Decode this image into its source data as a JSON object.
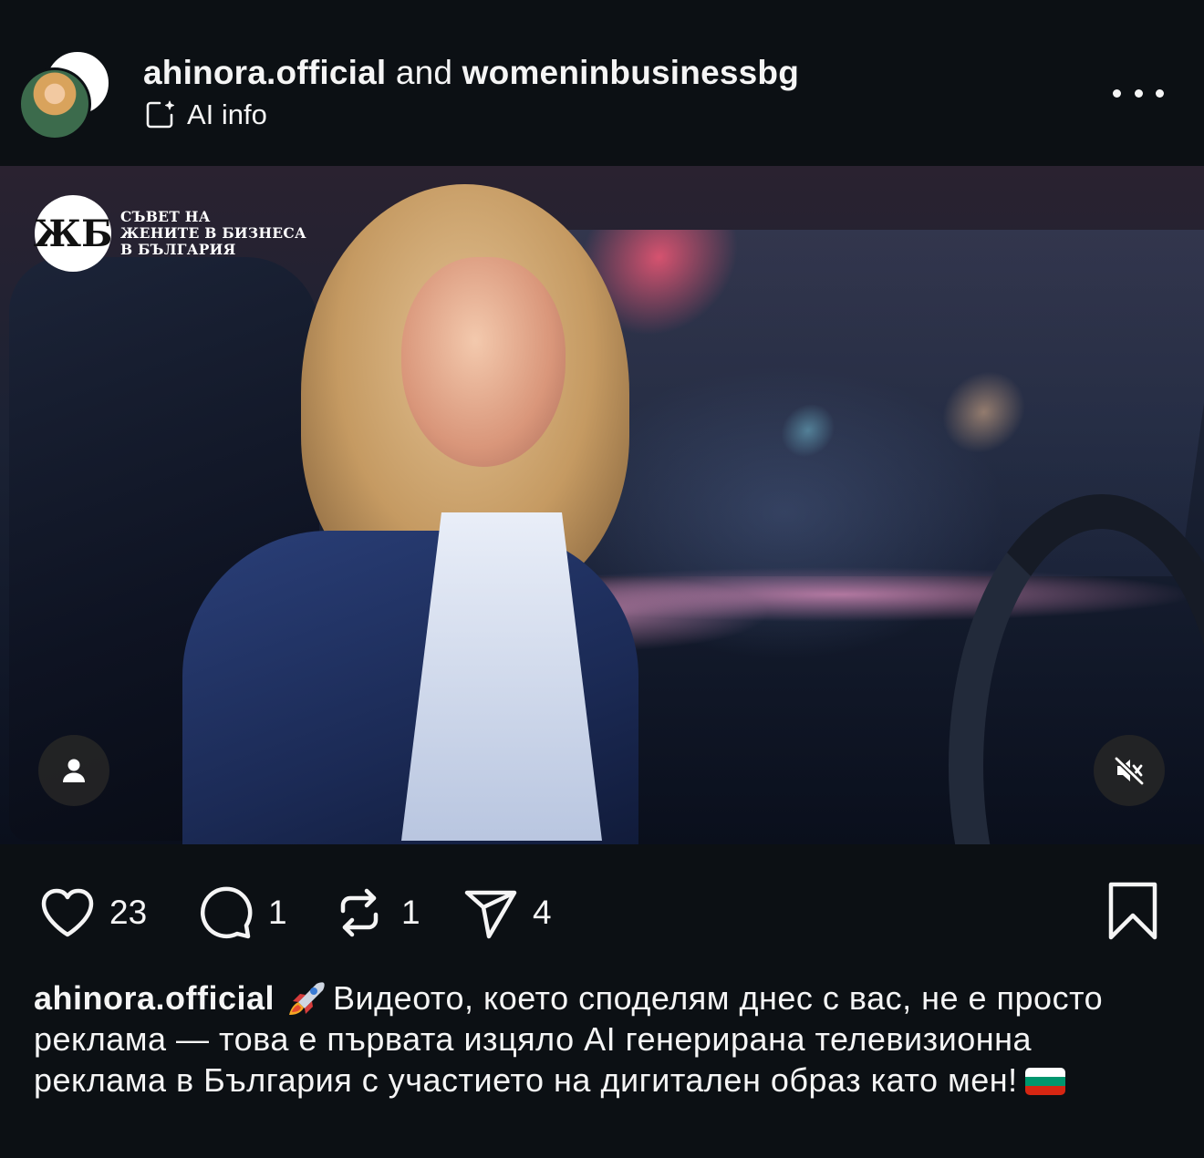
{
  "header": {
    "author_primary": "ahinora.official",
    "joiner": "and",
    "author_secondary": "womeninbusinessbg",
    "ai_label": "AI info",
    "more_icon": "more-horizontal-icon"
  },
  "media": {
    "watermark_lines": [
      "СЪВЕТ НА",
      "ЖЕНИТЕ В БИЗНЕСА",
      "В БЪЛГАРИЯ"
    ],
    "tags_icon": "person-icon",
    "mute_icon": "speaker-muted-icon"
  },
  "actions": {
    "like_count": "23",
    "comment_count": "1",
    "repost_count": "1",
    "share_count": "4"
  },
  "caption": {
    "username": "ahinora.official",
    "text": "Видеото, което споделям днес с вас, не е просто реклама — това е първата изцяло AI генерирана телевизионна реклама в България с участието на дигитален образ като мен!",
    "flag_colors": [
      "#ffffff",
      "#00966e",
      "#d62612"
    ]
  },
  "colors": {
    "background": "#0c1014",
    "text": "#f5f5f5"
  }
}
